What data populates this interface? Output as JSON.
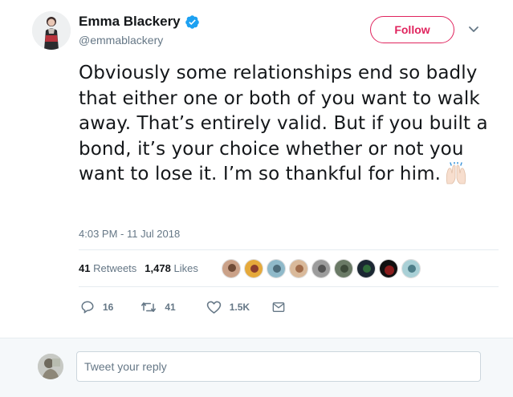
{
  "user": {
    "name": "Emma Blackery",
    "handle": "@emmablackery",
    "follow_label": "Follow"
  },
  "tweet": {
    "text": "Obviously some relationships end so badly that either one or both of you want to walk away. That’s entirely valid. But if you built a bond, it’s your choice whether or not you want to lose it. I’m so thankful for him.",
    "emoji": "raising-hands-emoji",
    "timestamp": "4:03 PM - 11 Jul 2018"
  },
  "stats": {
    "retweets_count": "41",
    "retweets_label": "Retweets",
    "likes_count": "1,478",
    "likes_label": "Likes"
  },
  "likers_count": 9,
  "actions": {
    "reply_count": "16",
    "retweet_count": "41",
    "like_count": "1.5K"
  },
  "reply": {
    "placeholder": "Tweet your reply"
  },
  "colors": {
    "accent_red": "#e0245e",
    "verified_blue": "#1da1f2",
    "muted_text": "#657786",
    "reply_bar_bg": "#f5f8fa"
  }
}
